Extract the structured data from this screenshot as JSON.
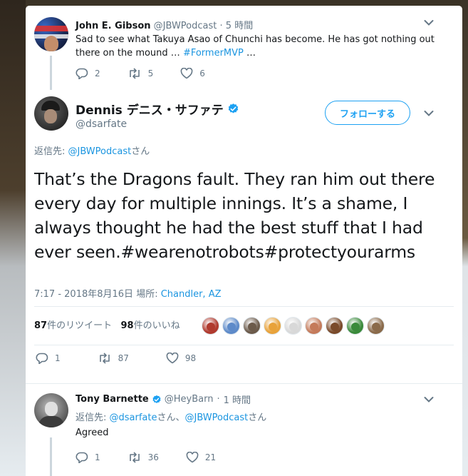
{
  "parent_tweet": {
    "name": "John E. Gibson",
    "handle": "@JBWPodcast",
    "separator": "·",
    "time": "5 時間",
    "text": "Sad to see what Takuya Asao of Chunchi has become. He has got nothing out there on the mound … ",
    "hashtag": "#FormerMVP",
    "ellipsis": " …",
    "replies": "2",
    "retweets": "5",
    "likes": "6"
  },
  "main_tweet": {
    "name": "Dennis デニス・サファテ",
    "handle": "@dsarfate",
    "follow_label": "フォローする",
    "reply_prefix": "返信先: ",
    "reply_to": "@JBWPodcast",
    "reply_suffix": "さん",
    "text": "That’s the Dragons fault. They ran him out there every day for multiple innings. It’s a shame, I always thought he had the best stuff that I had ever seen.",
    "hashtags": "#wearenotrobots#protectyourarms",
    "timestamp": "7:17 - 2018年8月16日",
    "location_label": "場所: ",
    "location": "Chandler, AZ",
    "retweet_count": "87",
    "retweet_label": "件のリツイート",
    "like_count": "98",
    "like_label": "件のいいね",
    "replies": "1",
    "retweets": "87",
    "likes": "98",
    "liker_colors": [
      "#b03a2e",
      "#5d8ac9",
      "#6b5a4a",
      "#e8a23a",
      "#d8d8d8",
      "#c47a5a",
      "#7a4a2a",
      "#3a8a3a",
      "#8a6a4a"
    ]
  },
  "reply_tweet": {
    "name": "Tony Barnette",
    "handle": "@HeyBarn",
    "separator": "·",
    "time": "1 時間",
    "reply_prefix": "返信先: ",
    "reply_to_1": "@dsarfate",
    "reply_mid": "さん、",
    "reply_to_2": "@JBWPodcast",
    "reply_suffix": "さん",
    "text": "Agreed",
    "replies": "1",
    "retweets": "36",
    "likes": "21"
  },
  "colors": {
    "link": "#1b95e0",
    "muted": "#657786",
    "verified": "#1da1f2"
  }
}
